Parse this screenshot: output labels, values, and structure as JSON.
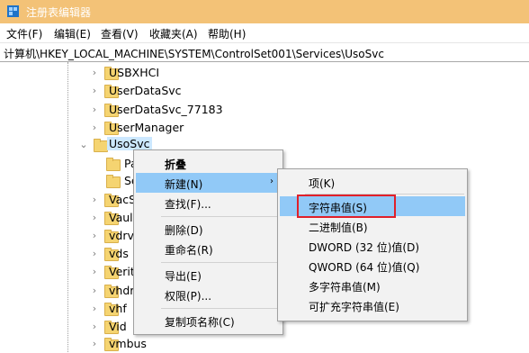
{
  "window": {
    "title": "注册表编辑器"
  },
  "menubar": [
    "文件(F)",
    "编辑(E)",
    "查看(V)",
    "收藏夹(A)",
    "帮助(H)"
  ],
  "address": "计算机\\HKEY_LOCAL_MACHINE\\SYSTEM\\ControlSet001\\Services\\UsoSvc",
  "tree": {
    "items": [
      {
        "label": "USBXHCI"
      },
      {
        "label": "UserDataSvc"
      },
      {
        "label": "UserDataSvc_77183"
      },
      {
        "label": "UserManager"
      },
      {
        "label": "UsoSvc"
      },
      {
        "label": "Pa"
      },
      {
        "label": "Se"
      },
      {
        "label": "VacS"
      },
      {
        "label": "Vaul"
      },
      {
        "label": "vdrv"
      },
      {
        "label": "vds"
      },
      {
        "label": "Verit"
      },
      {
        "label": "vhdr"
      },
      {
        "label": "vhf"
      },
      {
        "label": "Vid"
      },
      {
        "label": "vmbus"
      }
    ]
  },
  "context_menu": {
    "items": [
      "折叠",
      "新建(N)",
      "查找(F)...",
      "删除(D)",
      "重命名(R)",
      "导出(E)",
      "权限(P)...",
      "复制项名称(C)"
    ]
  },
  "submenu": {
    "items": [
      "项(K)",
      "字符串值(S)",
      "二进制值(B)",
      "DWORD (32 位)值(D)",
      "QWORD (64 位)值(Q)",
      "多字符串值(M)",
      "可扩充字符串值(E)"
    ]
  }
}
